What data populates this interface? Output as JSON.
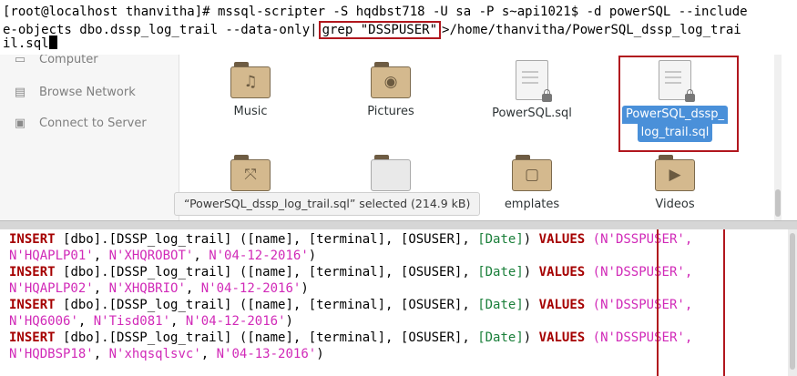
{
  "terminal_top": {
    "line1_pre": "[root@localhost thanvitha]# mssql-scripter -S hqdbst718 -U sa -P s~api1021$ -d powerSQL --include",
    "line2_pre": "e-objects dbo.dssp_log_trail --data-only|",
    "line2_grep": "grep \"DSSPUSER\"",
    "line2_post": ">/home/thanvitha/PowerSQL_dssp_log_trai",
    "line3": "il.sql"
  },
  "file_manager": {
    "sidebar": [
      {
        "label": "Computer",
        "icon": "computer-icon"
      },
      {
        "label": "Browse Network",
        "icon": "network-icon"
      },
      {
        "label": "Connect to Server",
        "icon": "server-icon"
      }
    ],
    "items": {
      "music": "Music",
      "pictures": "Pictures",
      "powersql": "PowerSQL.sql",
      "selected_line1": "PowerSQL_dssp_",
      "selected_line2": "log_trail.sql",
      "templates": "emplates",
      "videos": "Videos"
    },
    "status": "“PowerSQL_dssp_log_trail.sql” selected  (214.9 kB)"
  },
  "terminal_bottom": {
    "rows": [
      {
        "name": "HQAPLP01",
        "terminal": "XHQROBOT",
        "date": "04-12-2016"
      },
      {
        "name": "HQAPLP02",
        "terminal": "XHQBRIO",
        "date": "04-12-2016"
      },
      {
        "name": "HQ6006",
        "terminal": "Tisd081",
        "date": "04-12-2016"
      },
      {
        "name": "HQDBSP18",
        "terminal": "xhqsqlsvc",
        "date": "04-13-2016"
      }
    ],
    "insert_kw": "INSERT",
    "table": "[dbo].[DSSP_log_trail]",
    "columns": "([name], [terminal], [OSUSER],",
    "date_col": "[Date]",
    "values_kw": "VALUES",
    "osuser_prefix": "(N'",
    "osuser_value": "DSSPUSER",
    "osuser_suffix": "',"
  },
  "colors": {
    "keyword": "#a50000",
    "string": "#d12ab8",
    "type": "#1a7f3a",
    "highlight_box": "#b1171e",
    "selection": "#4a90d9"
  }
}
